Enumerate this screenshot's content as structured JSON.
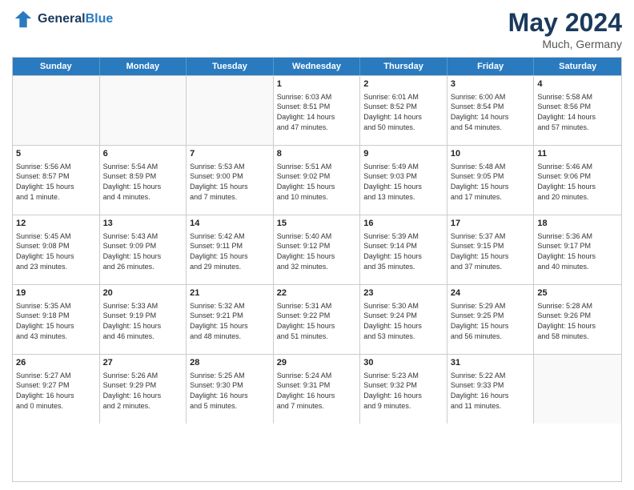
{
  "header": {
    "logo_general": "General",
    "logo_blue": "Blue",
    "month": "May 2024",
    "location": "Much, Germany"
  },
  "weekdays": [
    "Sunday",
    "Monday",
    "Tuesday",
    "Wednesday",
    "Thursday",
    "Friday",
    "Saturday"
  ],
  "weeks": [
    [
      {
        "day": "",
        "content": ""
      },
      {
        "day": "",
        "content": ""
      },
      {
        "day": "",
        "content": ""
      },
      {
        "day": "1",
        "content": "Sunrise: 6:03 AM\nSunset: 8:51 PM\nDaylight: 14 hours\nand 47 minutes."
      },
      {
        "day": "2",
        "content": "Sunrise: 6:01 AM\nSunset: 8:52 PM\nDaylight: 14 hours\nand 50 minutes."
      },
      {
        "day": "3",
        "content": "Sunrise: 6:00 AM\nSunset: 8:54 PM\nDaylight: 14 hours\nand 54 minutes."
      },
      {
        "day": "4",
        "content": "Sunrise: 5:58 AM\nSunset: 8:56 PM\nDaylight: 14 hours\nand 57 minutes."
      }
    ],
    [
      {
        "day": "5",
        "content": "Sunrise: 5:56 AM\nSunset: 8:57 PM\nDaylight: 15 hours\nand 1 minute."
      },
      {
        "day": "6",
        "content": "Sunrise: 5:54 AM\nSunset: 8:59 PM\nDaylight: 15 hours\nand 4 minutes."
      },
      {
        "day": "7",
        "content": "Sunrise: 5:53 AM\nSunset: 9:00 PM\nDaylight: 15 hours\nand 7 minutes."
      },
      {
        "day": "8",
        "content": "Sunrise: 5:51 AM\nSunset: 9:02 PM\nDaylight: 15 hours\nand 10 minutes."
      },
      {
        "day": "9",
        "content": "Sunrise: 5:49 AM\nSunset: 9:03 PM\nDaylight: 15 hours\nand 13 minutes."
      },
      {
        "day": "10",
        "content": "Sunrise: 5:48 AM\nSunset: 9:05 PM\nDaylight: 15 hours\nand 17 minutes."
      },
      {
        "day": "11",
        "content": "Sunrise: 5:46 AM\nSunset: 9:06 PM\nDaylight: 15 hours\nand 20 minutes."
      }
    ],
    [
      {
        "day": "12",
        "content": "Sunrise: 5:45 AM\nSunset: 9:08 PM\nDaylight: 15 hours\nand 23 minutes."
      },
      {
        "day": "13",
        "content": "Sunrise: 5:43 AM\nSunset: 9:09 PM\nDaylight: 15 hours\nand 26 minutes."
      },
      {
        "day": "14",
        "content": "Sunrise: 5:42 AM\nSunset: 9:11 PM\nDaylight: 15 hours\nand 29 minutes."
      },
      {
        "day": "15",
        "content": "Sunrise: 5:40 AM\nSunset: 9:12 PM\nDaylight: 15 hours\nand 32 minutes."
      },
      {
        "day": "16",
        "content": "Sunrise: 5:39 AM\nSunset: 9:14 PM\nDaylight: 15 hours\nand 35 minutes."
      },
      {
        "day": "17",
        "content": "Sunrise: 5:37 AM\nSunset: 9:15 PM\nDaylight: 15 hours\nand 37 minutes."
      },
      {
        "day": "18",
        "content": "Sunrise: 5:36 AM\nSunset: 9:17 PM\nDaylight: 15 hours\nand 40 minutes."
      }
    ],
    [
      {
        "day": "19",
        "content": "Sunrise: 5:35 AM\nSunset: 9:18 PM\nDaylight: 15 hours\nand 43 minutes."
      },
      {
        "day": "20",
        "content": "Sunrise: 5:33 AM\nSunset: 9:19 PM\nDaylight: 15 hours\nand 46 minutes."
      },
      {
        "day": "21",
        "content": "Sunrise: 5:32 AM\nSunset: 9:21 PM\nDaylight: 15 hours\nand 48 minutes."
      },
      {
        "day": "22",
        "content": "Sunrise: 5:31 AM\nSunset: 9:22 PM\nDaylight: 15 hours\nand 51 minutes."
      },
      {
        "day": "23",
        "content": "Sunrise: 5:30 AM\nSunset: 9:24 PM\nDaylight: 15 hours\nand 53 minutes."
      },
      {
        "day": "24",
        "content": "Sunrise: 5:29 AM\nSunset: 9:25 PM\nDaylight: 15 hours\nand 56 minutes."
      },
      {
        "day": "25",
        "content": "Sunrise: 5:28 AM\nSunset: 9:26 PM\nDaylight: 15 hours\nand 58 minutes."
      }
    ],
    [
      {
        "day": "26",
        "content": "Sunrise: 5:27 AM\nSunset: 9:27 PM\nDaylight: 16 hours\nand 0 minutes."
      },
      {
        "day": "27",
        "content": "Sunrise: 5:26 AM\nSunset: 9:29 PM\nDaylight: 16 hours\nand 2 minutes."
      },
      {
        "day": "28",
        "content": "Sunrise: 5:25 AM\nSunset: 9:30 PM\nDaylight: 16 hours\nand 5 minutes."
      },
      {
        "day": "29",
        "content": "Sunrise: 5:24 AM\nSunset: 9:31 PM\nDaylight: 16 hours\nand 7 minutes."
      },
      {
        "day": "30",
        "content": "Sunrise: 5:23 AM\nSunset: 9:32 PM\nDaylight: 16 hours\nand 9 minutes."
      },
      {
        "day": "31",
        "content": "Sunrise: 5:22 AM\nSunset: 9:33 PM\nDaylight: 16 hours\nand 11 minutes."
      },
      {
        "day": "",
        "content": ""
      }
    ]
  ]
}
